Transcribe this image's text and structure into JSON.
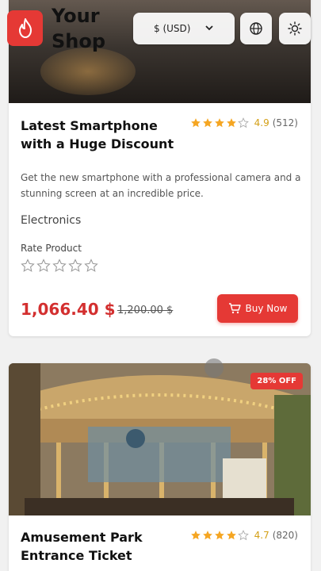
{
  "header": {
    "brand_line1": "Your",
    "brand_line2": "Shop",
    "currency": "$ (USD)",
    "icons": [
      "flame-icon",
      "chevron-down-icon",
      "globe-icon",
      "sun-icon"
    ]
  },
  "products": [
    {
      "title": "Latest Smartphone with a Huge Discount",
      "rating": "4.9",
      "rating_count": "(512)",
      "stars_filled": 4,
      "description": "Get the new smartphone with a professional camera and a stunning screen at an incredible price.",
      "category": "Electronics",
      "rate_label": "Rate Product",
      "price": "1,066.40 $",
      "old_price": "1,200.00 $",
      "buy_label": "Buy Now"
    },
    {
      "title": "Amusement Park Entrance Ticket",
      "rating": "4.7",
      "rating_count": "(820)",
      "stars_filled": 4,
      "badge": "28% OFF"
    }
  ],
  "colors": {
    "accent": "#e53935",
    "star": "#f5a623",
    "price": "#d32f2f"
  }
}
